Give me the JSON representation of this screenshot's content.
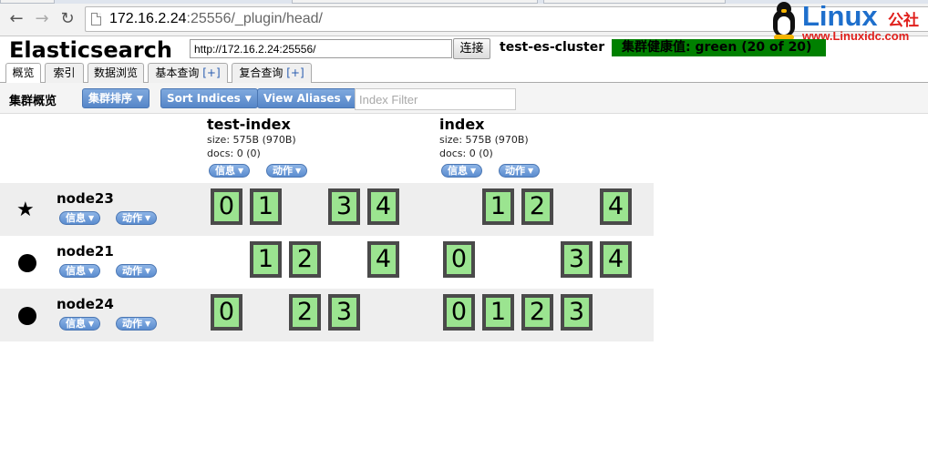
{
  "browser": {
    "url_host": "172.16.2.24",
    "url_rest": ":25556/_plugin/head/"
  },
  "logo": {
    "brand": "Linux",
    "brand_cn": "公社",
    "site": "www.Linuxidc.com"
  },
  "header": {
    "title": "Elasticsearch",
    "connect_url": "http://172.16.2.24:25556/",
    "connect_label": "连接",
    "cluster_name": "test-es-cluster",
    "health": "集群健康值: green (20 of 20)",
    "health_color": "#008000"
  },
  "tabs": [
    {
      "label": "概览"
    },
    {
      "label": "索引"
    },
    {
      "label": "数据浏览"
    },
    {
      "label": "基本查询",
      "plus": "[+]"
    },
    {
      "label": "复合查询",
      "plus": "[+]"
    }
  ],
  "toolbar": {
    "title": "集群概览",
    "sort_cluster": "集群排序",
    "sort_indices": "Sort Indices",
    "view_aliases": "View Aliases",
    "filter_placeholder": "Index Filter"
  },
  "actions": {
    "info": "信息",
    "action": "动作"
  },
  "indices": [
    {
      "name": "test-index",
      "size": "size: 575B (970B)",
      "docs": "docs: 0 (0)"
    },
    {
      "name": "index",
      "size": "size: 575B (970B)",
      "docs": "docs: 0 (0)"
    }
  ],
  "nodes": [
    {
      "name": "node23",
      "master": true,
      "shards": [
        [
          "0",
          "1",
          "3",
          "4"
        ],
        [
          "1",
          "2",
          "4"
        ]
      ]
    },
    {
      "name": "node21",
      "master": false,
      "shards": [
        [
          "1",
          "2",
          "4"
        ],
        [
          "0",
          "3",
          "4"
        ]
      ]
    },
    {
      "name": "node24",
      "master": false,
      "shards": [
        [
          "0",
          "2",
          "3"
        ],
        [
          "0",
          "1",
          "2",
          "3"
        ]
      ]
    }
  ],
  "colors": {
    "shard_fill": "#9be490",
    "shard_border": "#4a4a4a",
    "button_blue": "#5686c8"
  }
}
